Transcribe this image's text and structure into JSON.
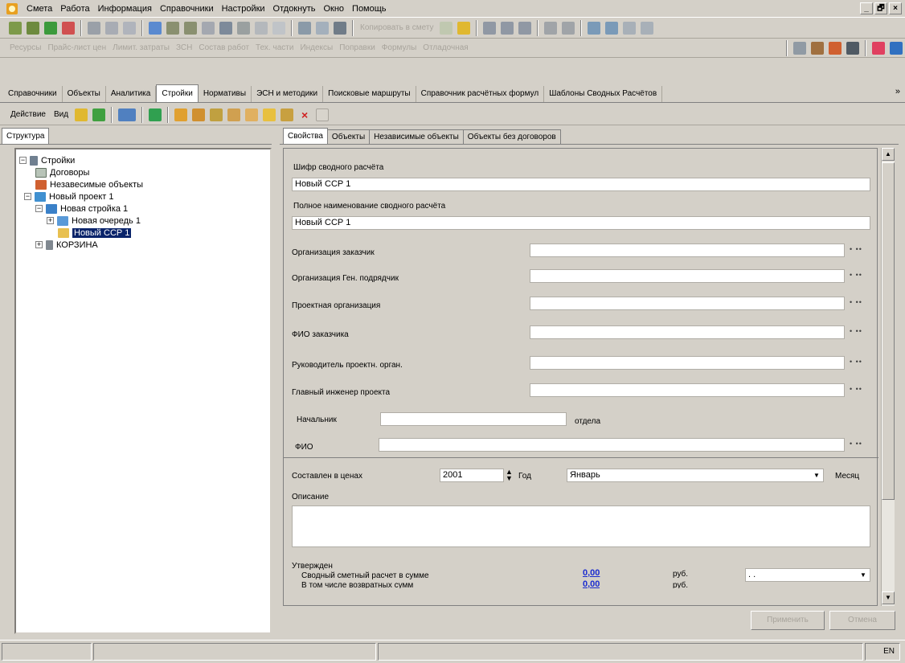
{
  "menubar": {
    "items": [
      "Смета",
      "Работа",
      "Информация",
      "Справочники",
      "Настройки",
      "Отдокнуть",
      "Окно",
      "Помощь"
    ],
    "window_buttons": [
      "_",
      "🗗",
      "×"
    ]
  },
  "toolbar1": {
    "copy_to_estimate": "Копировать в смету"
  },
  "toolbar2": {
    "items": [
      "Ресурсы",
      "Прайс-лист цен",
      "Лимит. затраты",
      "ЗСН",
      "Состав работ",
      "Тех. части",
      "Индексы",
      "Поправки",
      "Формулы",
      "Отладочная"
    ]
  },
  "main_tabs": [
    "Справочники",
    "Объекты",
    "Аналитика",
    "Стройки",
    "Нормативы",
    "ЭСН и методики",
    "Поисковые маршруты",
    "Справочник расчётных формул",
    "Шаблоны Сводных Расчётов"
  ],
  "main_tabs_active": 3,
  "actionbar": {
    "action": "Действие",
    "view": "Вид"
  },
  "left_panel": {
    "tab": "Структура"
  },
  "tree": [
    {
      "label": "Стройки",
      "level": 0,
      "exp": "−"
    },
    {
      "label": "Договоры",
      "level": 1,
      "exp": ""
    },
    {
      "label": "Незавесимые объекты",
      "level": 1,
      "exp": ""
    },
    {
      "label": "Новый проект 1",
      "level": 1,
      "exp": "−"
    },
    {
      "label": "Новая стройка 1",
      "level": 2,
      "exp": "−"
    },
    {
      "label": "Новая очередь 1",
      "level": 3,
      "exp": "+"
    },
    {
      "label": "Новый ССР 1",
      "level": 3,
      "exp": "",
      "selected": true
    },
    {
      "label": "КОРЗИНА",
      "level": 1,
      "exp": "+"
    }
  ],
  "right_tabs": [
    "Свойства",
    "Объекты",
    "Независимые объекты",
    "Объекты без договоров"
  ],
  "form": {
    "cipher_label": "Шифр сводного расчёта",
    "cipher_value": "Новый ССР 1",
    "fullname_label": "Полное наименование сводного расчёта",
    "fullname_value": "Новый ССР 1",
    "customer_org": "Организация заказчик",
    "gencontractor_org": "Организация Ген. подрядчик",
    "project_org": "Проектная организация",
    "customer_fio": "ФИО заказчика",
    "project_head": "Руководитель проектн. орган.",
    "chief_engineer": "Главный инженер проекта",
    "dept_head": "Начальник",
    "dept_suffix": "отдела",
    "fio": "ФИО",
    "prices_label": "Составлен в ценах",
    "year_value": "2001",
    "year_label": "Год",
    "month_value": "Январь",
    "month_label": "Месяц",
    "description_label": "Описание",
    "approved_label": "Утвержден",
    "summary_label": "Сводный сметный расчет в сумме",
    "summary_amount": "0,00",
    "summary_currency": "руб.",
    "returns_label": "В том числе возвратных сумм",
    "returns_amount": "0,00",
    "returns_currency": "руб.",
    "date_placeholder": ". .",
    "ellipsis": "• ••"
  },
  "buttons": {
    "apply": "Применить",
    "cancel": "Отмена"
  },
  "statusbar": {
    "lang": "EN"
  },
  "colors": {
    "selection": "#0a246a",
    "amount": "#1a2bd0",
    "chrome": "#d4d0c8"
  }
}
